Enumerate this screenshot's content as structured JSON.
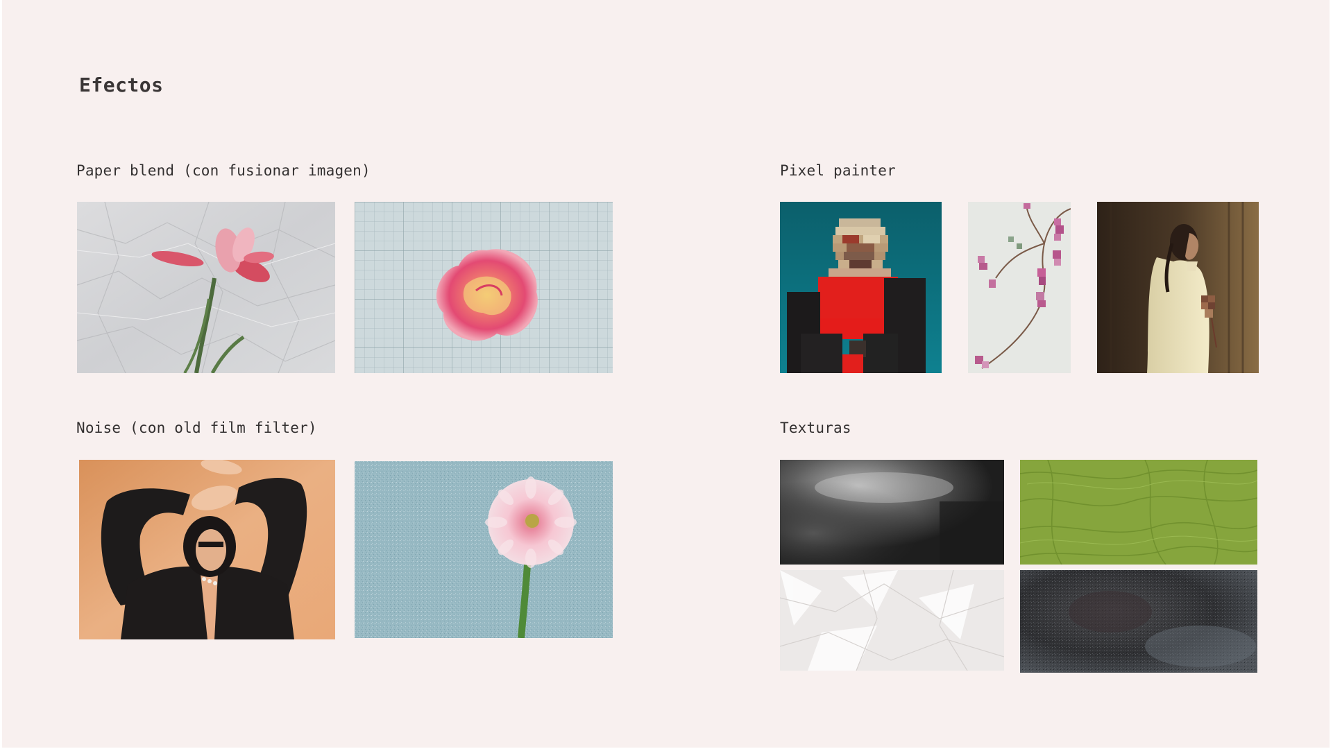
{
  "page": {
    "title": "Efectos"
  },
  "sections": {
    "paper_blend": {
      "label": "Paper blend (con fusionar imagen)"
    },
    "pixel_painter": {
      "label": "Pixel painter"
    },
    "noise": {
      "label": "Noise (con old film filter)"
    },
    "texturas": {
      "label": "Texturas"
    }
  },
  "colors": {
    "background": "#f8f0ef",
    "text": "#333030"
  }
}
